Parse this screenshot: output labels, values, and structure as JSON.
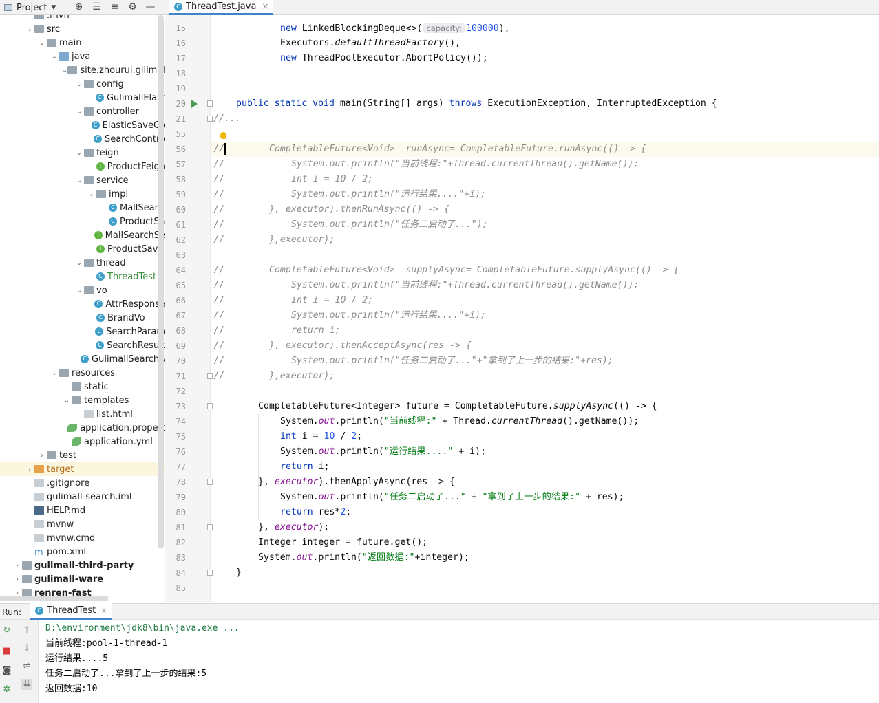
{
  "toolbar": {
    "project_label": "Project"
  },
  "editor_tab": {
    "filename": "ThreadTest.java"
  },
  "tree": [
    {
      "label": ".mvn",
      "indent": 56,
      "icon": "folder",
      "arrow": ""
    },
    {
      "label": "src",
      "indent": 56,
      "icon": "folder",
      "arrow": "v"
    },
    {
      "label": "main",
      "indent": 74,
      "icon": "folder",
      "arrow": "v"
    },
    {
      "label": "java",
      "indent": 92,
      "icon": "folder-blue",
      "arrow": "v"
    },
    {
      "label": "site.zhourui.gilimall",
      "indent": 110,
      "icon": "folder",
      "arrow": "v"
    },
    {
      "label": "config",
      "indent": 128,
      "icon": "folder",
      "arrow": "v"
    },
    {
      "label": "GulimallElast",
      "indent": 146,
      "icon": "class",
      "arrow": ""
    },
    {
      "label": "controller",
      "indent": 128,
      "icon": "folder",
      "arrow": "v"
    },
    {
      "label": "ElasticSaveCo",
      "indent": 146,
      "icon": "class",
      "arrow": ""
    },
    {
      "label": "SearchContro",
      "indent": 146,
      "icon": "class",
      "arrow": ""
    },
    {
      "label": "feign",
      "indent": 128,
      "icon": "folder",
      "arrow": "v"
    },
    {
      "label": "ProductFeign",
      "indent": 146,
      "icon": "interface",
      "arrow": ""
    },
    {
      "label": "service",
      "indent": 128,
      "icon": "folder",
      "arrow": "v"
    },
    {
      "label": "impl",
      "indent": 146,
      "icon": "folder",
      "arrow": "v"
    },
    {
      "label": "MallSearc",
      "indent": 164,
      "icon": "class",
      "arrow": ""
    },
    {
      "label": "ProductSa",
      "indent": 164,
      "icon": "class",
      "arrow": ""
    },
    {
      "label": "MallSearchSe",
      "indent": 146,
      "icon": "interface",
      "arrow": ""
    },
    {
      "label": "ProductSave",
      "indent": 146,
      "icon": "interface",
      "arrow": ""
    },
    {
      "label": "thread",
      "indent": 128,
      "icon": "folder",
      "arrow": "v"
    },
    {
      "label": "ThreadTest",
      "indent": 146,
      "icon": "class",
      "arrow": "",
      "style": "green"
    },
    {
      "label": "vo",
      "indent": 128,
      "icon": "folder",
      "arrow": "v"
    },
    {
      "label": "AttrResponse",
      "indent": 146,
      "icon": "class",
      "arrow": ""
    },
    {
      "label": "BrandVo",
      "indent": 146,
      "icon": "class",
      "arrow": ""
    },
    {
      "label": "SearchParam",
      "indent": 146,
      "icon": "class",
      "arrow": ""
    },
    {
      "label": "SearchResult",
      "indent": 146,
      "icon": "class",
      "arrow": ""
    },
    {
      "label": "GulimallSearchA",
      "indent": 128,
      "icon": "class",
      "arrow": ""
    },
    {
      "label": "resources",
      "indent": 92,
      "icon": "folder",
      "arrow": "v"
    },
    {
      "label": "static",
      "indent": 110,
      "icon": "folder",
      "arrow": ""
    },
    {
      "label": "templates",
      "indent": 110,
      "icon": "folder",
      "arrow": "v"
    },
    {
      "label": "list.html",
      "indent": 128,
      "icon": "file",
      "arrow": ""
    },
    {
      "label": "application.propert",
      "indent": 110,
      "icon": "leaf",
      "arrow": ""
    },
    {
      "label": "application.yml",
      "indent": 110,
      "icon": "leaf",
      "arrow": ""
    },
    {
      "label": "test",
      "indent": 74,
      "icon": "folder",
      "arrow": ">"
    },
    {
      "label": "target",
      "indent": 56,
      "icon": "folder-orange",
      "arrow": ">",
      "style": "orange"
    },
    {
      "label": ".gitignore",
      "indent": 56,
      "icon": "file",
      "arrow": ""
    },
    {
      "label": "gulimall-search.iml",
      "indent": 56,
      "icon": "file",
      "arrow": ""
    },
    {
      "label": "HELP.md",
      "indent": 56,
      "icon": "md",
      "arrow": ""
    },
    {
      "label": "mvnw",
      "indent": 56,
      "icon": "file",
      "arrow": ""
    },
    {
      "label": "mvnw.cmd",
      "indent": 56,
      "icon": "file",
      "arrow": ""
    },
    {
      "label": "pom.xml",
      "indent": 56,
      "icon": "maven",
      "arrow": ""
    },
    {
      "label": "gulimall-third-party",
      "indent": 38,
      "icon": "folder",
      "arrow": ">",
      "style": "bold"
    },
    {
      "label": "gulimall-ware",
      "indent": 38,
      "icon": "folder",
      "arrow": ">",
      "style": "bold"
    },
    {
      "label": "renren-fast",
      "indent": 38,
      "icon": "folder",
      "arrow": ">",
      "style": "bold"
    }
  ],
  "line_numbers": [
    "15",
    "16",
    "17",
    "18",
    "19",
    "20",
    "21",
    "55",
    "56",
    "57",
    "58",
    "59",
    "60",
    "61",
    "62",
    "63",
    "64",
    "65",
    "66",
    "67",
    "68",
    "69",
    "70",
    "71",
    "72",
    "73",
    "74",
    "75",
    "76",
    "77",
    "78",
    "79",
    "80",
    "81",
    "82",
    "83",
    "84",
    "85"
  ],
  "code": {
    "l15": [
      "new",
      " LinkedBlockingDeque<>(",
      "capacity:",
      "100000",
      "),"
    ],
    "l16": [
      "Executors.",
      "defaultThreadFactory",
      "(),"
    ],
    "l17": [
      "new",
      " ThreadPoolExecutor.AbortPolicy());"
    ],
    "l20": [
      "public static void",
      " main(String[] args) ",
      "throws",
      " ExecutionException, InterruptedException {"
    ],
    "l21": "//...",
    "l56": [
      "//",
      "CompletableFuture<Void>  runAsync= CompletableFuture.runAsync(() -> {"
    ],
    "l57": [
      "//",
      "System.out.println(\"当前线程:\"+Thread.currentThread().getName());"
    ],
    "l58": [
      "//",
      "int i = 10 / 2;"
    ],
    "l59": [
      "//",
      "System.out.println(\"运行结果....\"+i);"
    ],
    "l60": [
      "//",
      "}, executor).thenRunAsync(() -> {"
    ],
    "l61": [
      "//",
      "System.out.println(\"任务二启动了...\");"
    ],
    "l62": [
      "//",
      "},executor);"
    ],
    "l64": [
      "//",
      "CompletableFuture<Void>  supplyAsync= CompletableFuture.supplyAsync(() -> {"
    ],
    "l65": [
      "//",
      "System.out.println(\"当前线程:\"+Thread.currentThread().getName());"
    ],
    "l66": [
      "//",
      "int i = 10 / 2;"
    ],
    "l67": [
      "//",
      "System.out.println(\"运行结果....\"+i);"
    ],
    "l68": [
      "//",
      "return i;"
    ],
    "l69": [
      "//",
      "}, executor).thenAcceptAsync(res -> {"
    ],
    "l70": [
      "//",
      "System.out.println(\"任务二启动了...\"+\"拿到了上一步的结果:\"+res);"
    ],
    "l71": [
      "//",
      "},executor);"
    ],
    "l73": [
      "CompletableFuture<Integer> future = CompletableFuture.",
      "supplyAsync",
      "(() -> {"
    ],
    "l74": [
      "System.",
      "out",
      ".println(",
      "\"当前线程:\"",
      " + Thread.",
      "currentThread",
      "().getName());"
    ],
    "l75": [
      "int",
      " i = ",
      "10",
      " / ",
      "2",
      ";"
    ],
    "l76": [
      "System.",
      "out",
      ".println(",
      "\"运行结果....\"",
      " + i);"
    ],
    "l77": [
      "return",
      " i;"
    ],
    "l78": [
      "}, ",
      "executor",
      ").thenApplyAsync(res -> {"
    ],
    "l79": [
      "System.",
      "out",
      ".println(",
      "\"任务二启动了...\"",
      " + ",
      "\"拿到了上一步的结果:\"",
      " + res);"
    ],
    "l80": [
      "return",
      " res*",
      "2",
      ";"
    ],
    "l81": [
      "}, ",
      "executor",
      ");"
    ],
    "l82": [
      "Integer integer = future.get();"
    ],
    "l83": [
      "System.",
      "out",
      ".println(",
      "\"返回数据:\"",
      "+integer);"
    ],
    "l84": [
      "}"
    ]
  },
  "run_panel": {
    "label": "Run:",
    "tab": "ThreadTest",
    "output": [
      "D:\\environment\\jdk8\\bin\\java.exe ...",
      "当前线程:pool-1-thread-1",
      "运行结果....5",
      "任务二启动了...拿到了上一步的结果:5",
      "返回数据:10"
    ]
  }
}
